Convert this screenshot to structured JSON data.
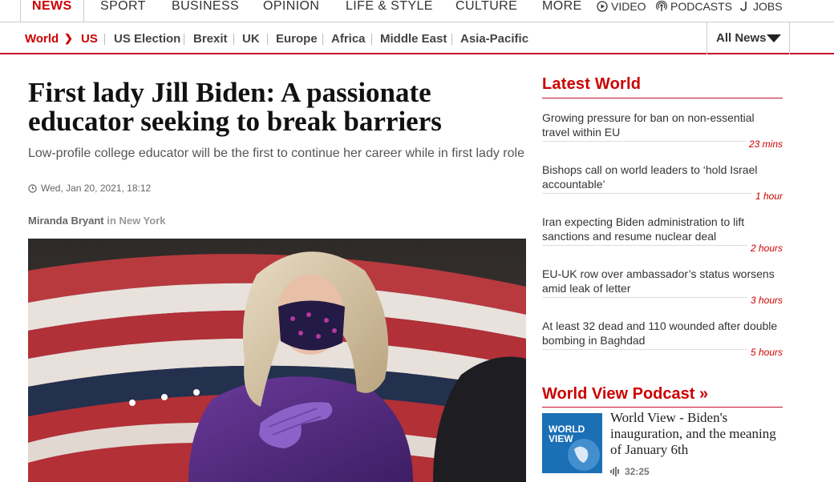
{
  "topnav": {
    "items": [
      "NEWS",
      "SPORT",
      "BUSINESS",
      "OPINION",
      "LIFE & STYLE",
      "CULTURE",
      "MORE"
    ],
    "media": [
      "VIDEO",
      "PODCASTS",
      "JOBS"
    ]
  },
  "subnav": {
    "world": "World",
    "us": "US",
    "links": [
      "US Election",
      "Brexit",
      "UK",
      "Europe",
      "Africa",
      "Middle East",
      "Asia-Pacific"
    ],
    "all_news": "All News"
  },
  "article": {
    "headline": "First lady Jill Biden: A passionate educator seeking to break barriers",
    "standfirst": "Low-profile college educator will be the first to continue her career while in first lady role",
    "date": "Wed, Jan 20, 2021, 18:12",
    "author": "Miranda Bryant",
    "in_word": "in",
    "location": "New York"
  },
  "sidebar": {
    "heading": "Latest World",
    "stories": [
      {
        "title": "Growing pressure for ban on non-essential travel within EU",
        "time": "23 mins"
      },
      {
        "title": "Bishops call on world leaders to ‘hold Israel accountable’",
        "time": "1 hour"
      },
      {
        "title": "Iran expecting Biden administration to lift sanctions and resume nuclear deal",
        "time": "2 hours"
      },
      {
        "title": "EU-UK row over ambassador’s status worsens amid leak of letter",
        "time": "3 hours"
      },
      {
        "title": "At least 32 dead and 110 wounded after double bombing in Baghdad",
        "time": "5 hours"
      }
    ],
    "podcast_heading": "World View Podcast »",
    "podcast": {
      "thumb_line1": "WORLD",
      "thumb_line2": "VIEW",
      "title": "World View - Biden's inauguration, and the meaning of January 6th",
      "duration": "32:25"
    }
  },
  "colors": {
    "accent": "#c8102e",
    "link_red": "#cc0000"
  }
}
